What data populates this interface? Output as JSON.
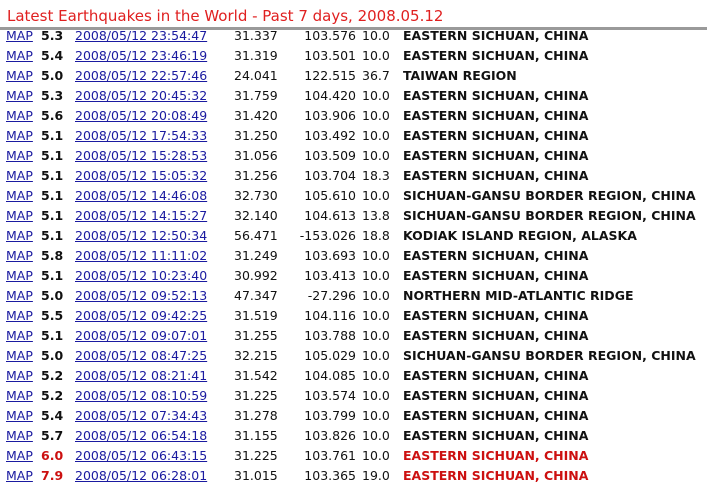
{
  "title": "Latest Earthquakes in the World - Past 7 days, 2008.05.12",
  "map_label": "MAP",
  "colors": {
    "title": "#e02020",
    "link": "#1a1aa0",
    "alert": "#cc1010",
    "rule": "#9a9a9a"
  },
  "quakes": [
    {
      "mag": "5.3",
      "time": "2008/05/12 23:54:47",
      "lat": "31.337",
      "lon": "103.576",
      "depth": "10.0",
      "region": "EASTERN SICHUAN, CHINA",
      "alert": false
    },
    {
      "mag": "5.4",
      "time": "2008/05/12 23:46:19",
      "lat": "31.319",
      "lon": "103.501",
      "depth": "10.0",
      "region": "EASTERN SICHUAN, CHINA",
      "alert": false
    },
    {
      "mag": "5.0",
      "time": "2008/05/12 22:57:46",
      "lat": "24.041",
      "lon": "122.515",
      "depth": "36.7",
      "region": "TAIWAN REGION",
      "alert": false
    },
    {
      "mag": "5.3",
      "time": "2008/05/12 20:45:32",
      "lat": "31.759",
      "lon": "104.420",
      "depth": "10.0",
      "region": "EASTERN SICHUAN, CHINA",
      "alert": false
    },
    {
      "mag": "5.6",
      "time": "2008/05/12 20:08:49",
      "lat": "31.420",
      "lon": "103.906",
      "depth": "10.0",
      "region": "EASTERN SICHUAN, CHINA",
      "alert": false
    },
    {
      "mag": "5.1",
      "time": "2008/05/12 17:54:33",
      "lat": "31.250",
      "lon": "103.492",
      "depth": "10.0",
      "region": "EASTERN SICHUAN, CHINA",
      "alert": false
    },
    {
      "mag": "5.1",
      "time": "2008/05/12 15:28:53",
      "lat": "31.056",
      "lon": "103.509",
      "depth": "10.0",
      "region": "EASTERN SICHUAN, CHINA",
      "alert": false
    },
    {
      "mag": "5.1",
      "time": "2008/05/12 15:05:32",
      "lat": "31.256",
      "lon": "103.704",
      "depth": "18.3",
      "region": "EASTERN SICHUAN, CHINA",
      "alert": false
    },
    {
      "mag": "5.1",
      "time": "2008/05/12 14:46:08",
      "lat": "32.730",
      "lon": "105.610",
      "depth": "10.0",
      "region": "SICHUAN-GANSU BORDER REGION, CHINA",
      "alert": false
    },
    {
      "mag": "5.1",
      "time": "2008/05/12 14:15:27",
      "lat": "32.140",
      "lon": "104.613",
      "depth": "13.8",
      "region": "SICHUAN-GANSU BORDER REGION, CHINA",
      "alert": false
    },
    {
      "mag": "5.1",
      "time": "2008/05/12 12:50:34",
      "lat": "56.471",
      "lon": "-153.026",
      "depth": "18.8",
      "region": "KODIAK ISLAND REGION, ALASKA",
      "alert": false
    },
    {
      "mag": "5.8",
      "time": "2008/05/12 11:11:02",
      "lat": "31.249",
      "lon": "103.693",
      "depth": "10.0",
      "region": "EASTERN SICHUAN, CHINA",
      "alert": false
    },
    {
      "mag": "5.1",
      "time": "2008/05/12 10:23:40",
      "lat": "30.992",
      "lon": "103.413",
      "depth": "10.0",
      "region": "EASTERN SICHUAN, CHINA",
      "alert": false
    },
    {
      "mag": "5.0",
      "time": "2008/05/12 09:52:13",
      "lat": "47.347",
      "lon": "-27.296",
      "depth": "10.0",
      "region": "NORTHERN MID-ATLANTIC RIDGE",
      "alert": false
    },
    {
      "mag": "5.5",
      "time": "2008/05/12 09:42:25",
      "lat": "31.519",
      "lon": "104.116",
      "depth": "10.0",
      "region": "EASTERN SICHUAN, CHINA",
      "alert": false
    },
    {
      "mag": "5.1",
      "time": "2008/05/12 09:07:01",
      "lat": "31.255",
      "lon": "103.788",
      "depth": "10.0",
      "region": "EASTERN SICHUAN, CHINA",
      "alert": false
    },
    {
      "mag": "5.0",
      "time": "2008/05/12 08:47:25",
      "lat": "32.215",
      "lon": "105.029",
      "depth": "10.0",
      "region": "SICHUAN-GANSU BORDER REGION, CHINA",
      "alert": false
    },
    {
      "mag": "5.2",
      "time": "2008/05/12 08:21:41",
      "lat": "31.542",
      "lon": "104.085",
      "depth": "10.0",
      "region": "EASTERN SICHUAN, CHINA",
      "alert": false
    },
    {
      "mag": "5.2",
      "time": "2008/05/12 08:10:59",
      "lat": "31.225",
      "lon": "103.574",
      "depth": "10.0",
      "region": "EASTERN SICHUAN, CHINA",
      "alert": false
    },
    {
      "mag": "5.4",
      "time": "2008/05/12 07:34:43",
      "lat": "31.278",
      "lon": "103.799",
      "depth": "10.0",
      "region": "EASTERN SICHUAN, CHINA",
      "alert": false
    },
    {
      "mag": "5.7",
      "time": "2008/05/12 06:54:18",
      "lat": "31.155",
      "lon": "103.826",
      "depth": "10.0",
      "region": "EASTERN SICHUAN, CHINA",
      "alert": false
    },
    {
      "mag": "6.0",
      "time": "2008/05/12 06:43:15",
      "lat": "31.225",
      "lon": "103.761",
      "depth": "10.0",
      "region": "EASTERN SICHUAN, CHINA",
      "alert": true
    },
    {
      "mag": "7.9",
      "time": "2008/05/12 06:28:01",
      "lat": "31.015",
      "lon": "103.365",
      "depth": "19.0",
      "region": "EASTERN SICHUAN, CHINA",
      "alert": true
    }
  ]
}
